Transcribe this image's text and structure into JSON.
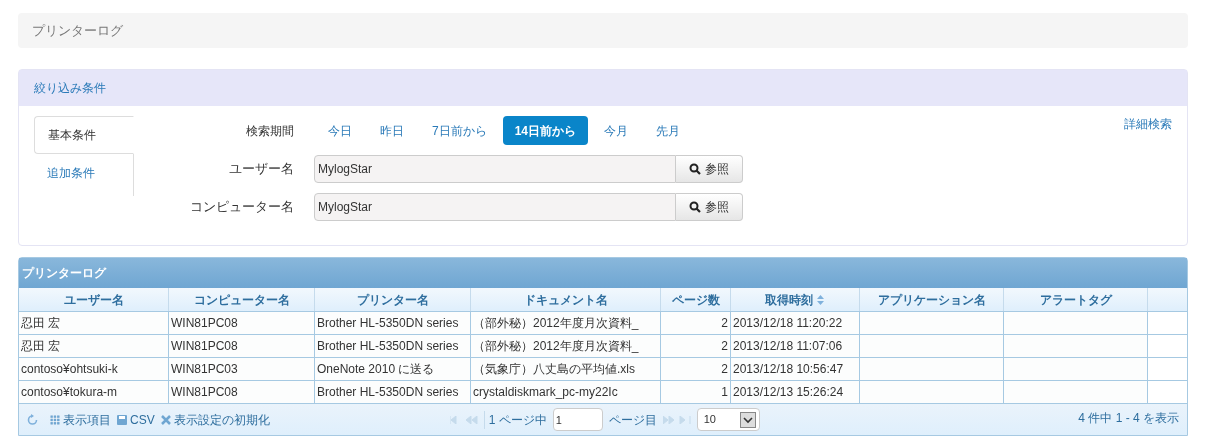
{
  "page_title": "プリンターログ",
  "filter": {
    "title": "絞り込み条件",
    "tabs": [
      {
        "label": "基本条件",
        "selected": true
      },
      {
        "label": "追加条件",
        "selected": false
      }
    ],
    "period_label": "検索期間",
    "periods": [
      {
        "label": "今日",
        "selected": false
      },
      {
        "label": "昨日",
        "selected": false
      },
      {
        "label": "7日前から",
        "selected": false
      },
      {
        "label": "14日前から",
        "selected": true
      },
      {
        "label": "今月",
        "selected": false
      },
      {
        "label": "先月",
        "selected": false
      }
    ],
    "advanced_link": "詳細検索",
    "fields": [
      {
        "label": "ユーザー名",
        "value": "MylogStar",
        "button": "参照"
      },
      {
        "label": "コンピューター名",
        "value": "MylogStar",
        "button": "参照"
      }
    ]
  },
  "grid": {
    "title": "プリンターログ",
    "columns": [
      {
        "label": "ユーザー名",
        "kind": "text",
        "sorted": false
      },
      {
        "label": "コンピューター名",
        "kind": "text",
        "sorted": false
      },
      {
        "label": "プリンター名",
        "kind": "text",
        "sorted": false
      },
      {
        "label": "ドキュメント名",
        "kind": "text",
        "sorted": false
      },
      {
        "label": "ページ数",
        "kind": "number",
        "sorted": false
      },
      {
        "label": "取得時刻",
        "kind": "text",
        "sorted": true
      },
      {
        "label": "アプリケーション名",
        "kind": "text",
        "sorted": false
      },
      {
        "label": "アラートタグ",
        "kind": "text",
        "sorted": false
      }
    ],
    "rows": [
      [
        "忍田 宏",
        "WIN81PC08",
        "Brother HL-5350DN series",
        "（部外秘）2012年度月次資料_",
        "2",
        "2013/12/18 11:20:22",
        "",
        ""
      ],
      [
        "忍田 宏",
        "WIN81PC08",
        "Brother HL-5350DN series",
        "（部外秘）2012年度月次資料_",
        "2",
        "2013/12/18 11:07:06",
        "",
        ""
      ],
      [
        "contoso¥ohtsuki-k",
        "WIN81PC03",
        "OneNote 2010 に送る",
        "（気象庁）八丈島の平均値.xls",
        "2",
        "2013/12/18 10:56:47",
        "",
        ""
      ],
      [
        "contoso¥tokura-m",
        "WIN81PC08",
        "Brother HL-5350DN series",
        "crystaldiskmark_pc-my22Ic",
        "1",
        "2013/12/13 15:26:24",
        "",
        ""
      ]
    ],
    "footer": {
      "columns_button": "表示項目",
      "csv_button": "CSV",
      "reset_button": "表示設定の初期化",
      "page_prefix": "1 ページ中",
      "page_value": "1",
      "page_suffix": "ページ目",
      "page_size": "10",
      "summary": "4 件中 1 - 4 を表示"
    }
  }
}
